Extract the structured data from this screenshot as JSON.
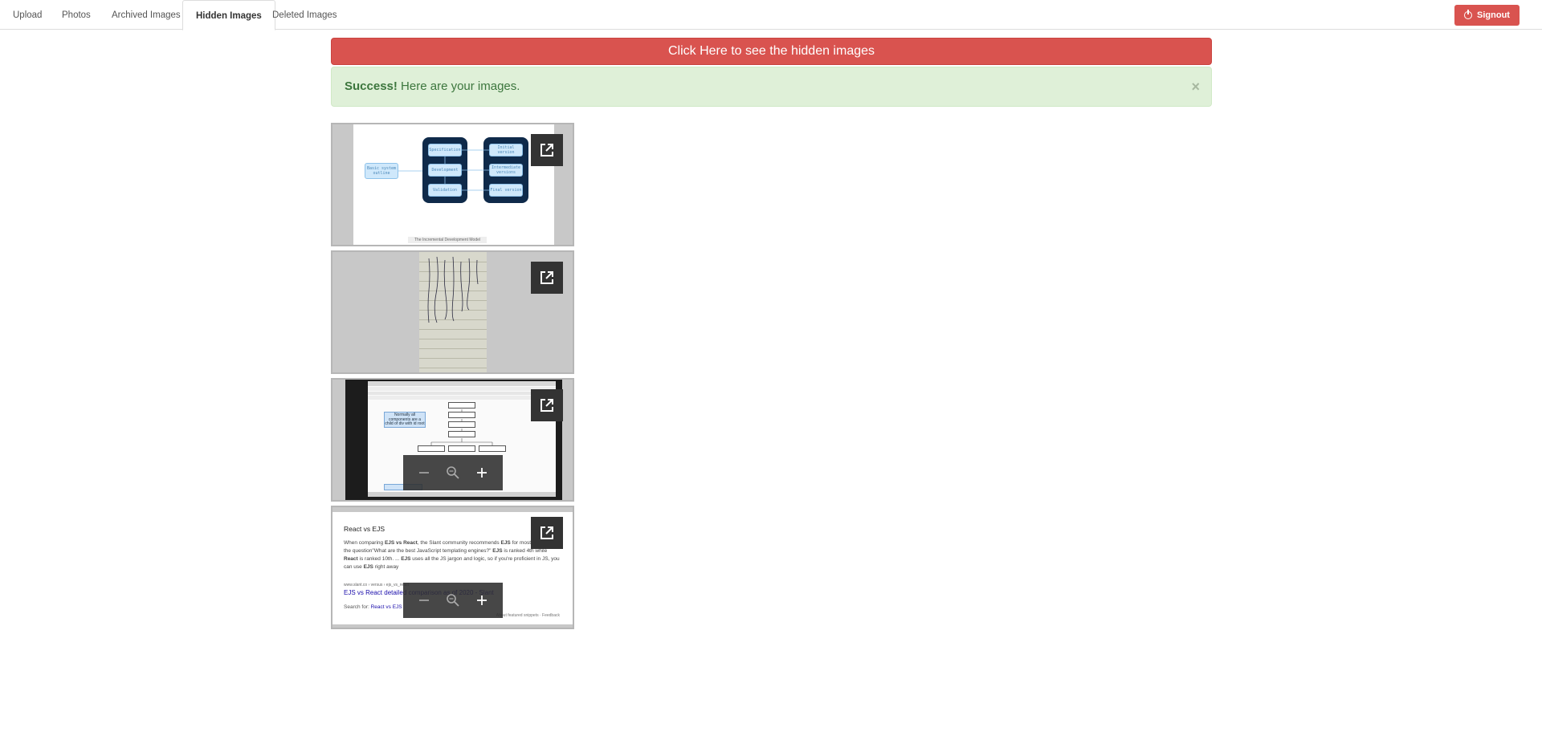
{
  "tabs": [
    {
      "label": "Upload"
    },
    {
      "label": "Photos"
    },
    {
      "label": "Archived Images"
    },
    {
      "label": "Hidden Images",
      "active": true
    },
    {
      "label": "Deleted Images"
    }
  ],
  "header": {
    "signout_label": "Signout"
  },
  "banner": {
    "label": "Click Here to see the hidden images"
  },
  "alert": {
    "strong": "Success!",
    "message": "Here are your images.",
    "close": "×"
  },
  "colors": {
    "danger": "#d9534f",
    "success_bg": "#dff0d8",
    "success_text": "#3c763d"
  },
  "gallery": {
    "icons": {
      "open": "open-in-new-icon",
      "zoom_out": "minus-icon",
      "zoom_reset": "zoom-icon",
      "zoom_in": "plus-icon"
    },
    "image1": {
      "left_box": "Basic system outline",
      "col1": [
        "Specification",
        "Development",
        "Validation"
      ],
      "col2": [
        "Initial version",
        "Intermediate versions",
        "Final version"
      ],
      "caption": "The Incremental Development Model"
    },
    "image3": {
      "note": "Normally all components are a child of div with id root",
      "nodes": [
        "Apply",
        "Div with id root",
        "Provider",
        "Main",
        "Route",
        "Route",
        "Route"
      ],
      "bottom_note": "Provider is our store provider"
    },
    "image4": {
      "title": "React vs EJS",
      "body_parts": [
        "When comparing ",
        "EJS vs React",
        ", the Slant community recommends ",
        "EJS",
        " for most people. In the question\"What are the best JavaScript templating engines?\" ",
        "EJS",
        " is ranked 4th while ",
        "React",
        " is ranked 10th. ... ",
        "EJS",
        " uses all the JS jargon and logic, so if you're proficient in JS, you can use ",
        "EJS",
        " right away"
      ],
      "url": "www.slant.co › versus › ejs_vs_react",
      "link": "EJS vs React detailed comparison as of 2020 - Slant",
      "search_for": "Search for: ",
      "search_link": "React vs EJS",
      "footer": "About featured snippets   ·   Feedback"
    }
  }
}
